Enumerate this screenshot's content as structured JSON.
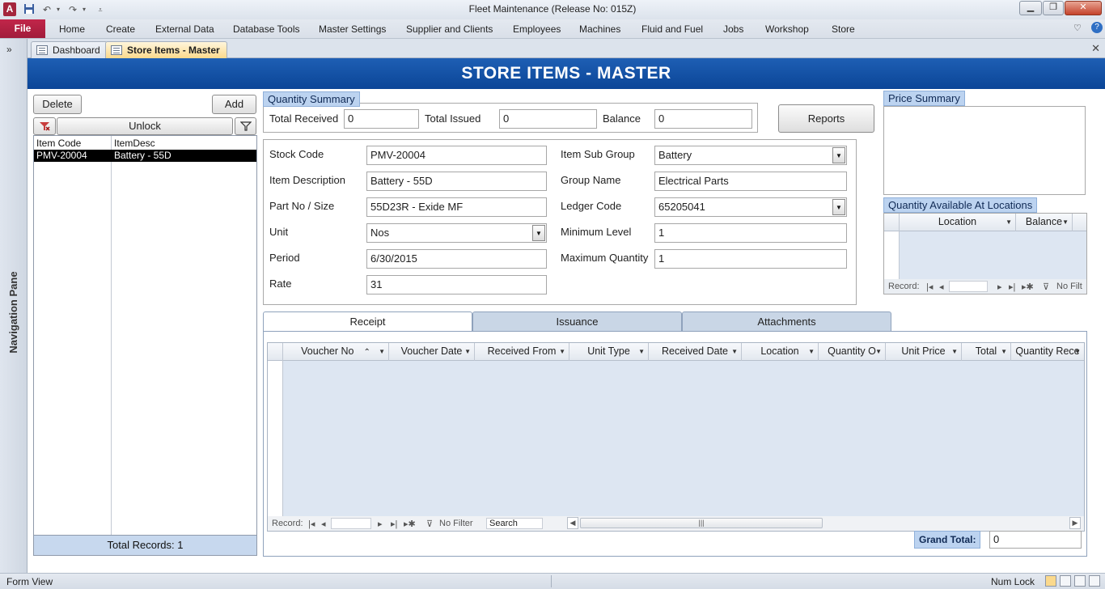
{
  "window": {
    "title": "Fleet Maintenance (Release No: 015Z)",
    "app_icon_letter": "A",
    "qat_icons": [
      "save-icon",
      "undo-icon",
      "redo-icon",
      "customize-icon"
    ],
    "controls": [
      "minimize",
      "restore",
      "close"
    ]
  },
  "ribbon": {
    "file_tab": "File",
    "tabs": [
      "Home",
      "Create",
      "External Data",
      "Database Tools",
      "Master Settings",
      "Supplier and Clients",
      "Employees",
      "Machines",
      "Fluid and Fuel",
      "Jobs",
      "Workshop",
      "Store"
    ]
  },
  "nav_pane": {
    "toggle": "»",
    "label": "Navigation Pane"
  },
  "doc_tabs": [
    {
      "label": "Dashboard",
      "active": false
    },
    {
      "label": "Store Items - Master",
      "active": true
    }
  ],
  "form": {
    "header": "STORE ITEMS - MASTER",
    "left": {
      "delete_label": "Delete",
      "add_label": "Add",
      "unlock_label": "Unlock",
      "columns": [
        "Item Code",
        "ItemDesc"
      ],
      "rows": [
        {
          "code": "PMV-20004",
          "desc": "Battery - 55D",
          "selected": true
        }
      ],
      "total_records": "Total Records: 1"
    },
    "quantity_summary": {
      "caption": "Quantity Summary",
      "total_received_label": "Total Received",
      "total_received": "0",
      "total_issued_label": "Total Issued",
      "total_issued": "0",
      "balance_label": "Balance",
      "balance": "0"
    },
    "reports_label": "Reports",
    "details": {
      "stock_code_label": "Stock Code",
      "stock_code": "PMV-20004",
      "item_description_label": "Item Description",
      "item_description": "Battery - 55D",
      "part_no_label": "Part No / Size",
      "part_no": "55D23R - Exide MF",
      "unit_label": "Unit",
      "unit": "Nos",
      "period_label": "Period",
      "period": "6/30/2015",
      "rate_label": "Rate",
      "rate": "31",
      "item_sub_group_label": "Item Sub Group",
      "item_sub_group": "Battery",
      "group_name_label": "Group Name",
      "group_name": "Electrical Parts",
      "ledger_code_label": "Ledger Code",
      "ledger_code": "65205041",
      "minimum_level_label": "Minimum Level",
      "minimum_level": "1",
      "maximum_quantity_label": "Maximum Quantity",
      "maximum_quantity": "1"
    },
    "price_summary": {
      "caption": "Price Summary"
    },
    "locations": {
      "caption": "Quantity Available At Locations",
      "columns": [
        "Location",
        "Balance"
      ],
      "nav": {
        "record_label": "Record:",
        "filter_label": "No Filt"
      }
    },
    "tabs": [
      "Receipt",
      "Issuance",
      "Attachments"
    ],
    "active_tab": "Receipt",
    "receipt_grid": {
      "columns": [
        "Voucher No",
        "Voucher Date",
        "Received From",
        "Unit Type",
        "Received Date",
        "Location",
        "Quantity O",
        "Unit Price",
        "Total",
        "Quantity Rece"
      ],
      "nav": {
        "record_label": "Record:",
        "filter_label": "No Filter",
        "search_label": "Search"
      }
    },
    "grand_total_label": "Grand Total:",
    "grand_total": "0"
  },
  "status_bar": {
    "left": "Form View",
    "num_lock": "Num Lock",
    "view_icons": [
      "form-view-icon",
      "datasheet-view-icon",
      "layout-view-icon",
      "design-view-icon"
    ]
  }
}
